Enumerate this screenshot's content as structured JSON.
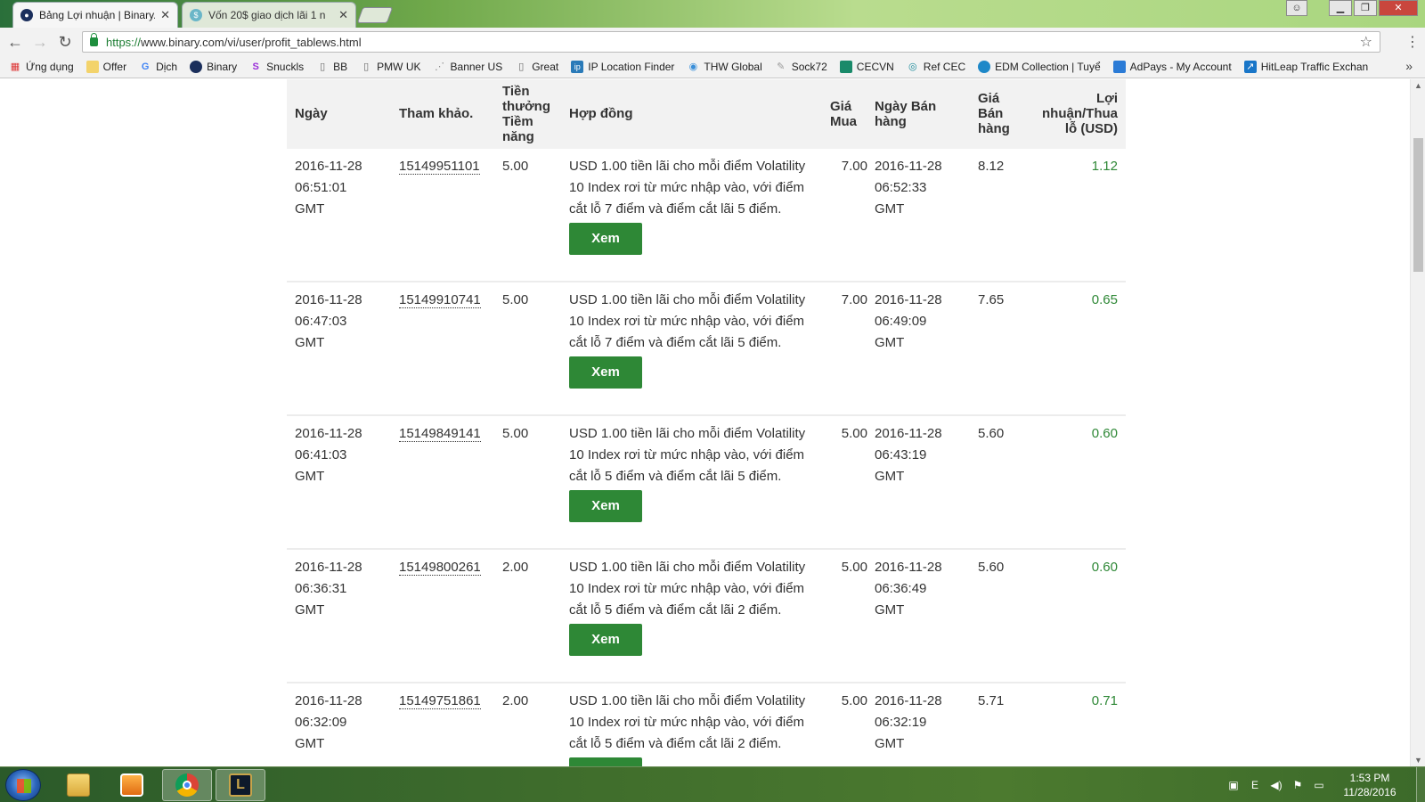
{
  "browser": {
    "tabs": [
      {
        "title": "Bảng Lợi nhuận | Binary.c",
        "active": true,
        "close": "✕"
      },
      {
        "title": "Vốn 20$ giao dịch lãi 1 n",
        "active": false,
        "close": "✕"
      }
    ],
    "url_prefix": "https://",
    "url_rest": "www.binary.com/vi/user/profit_tablews.html",
    "bookmarks": [
      {
        "label": "Ứng dụng",
        "icon": "apps-grid-icon"
      },
      {
        "label": "Offer",
        "icon": "folder-icon"
      },
      {
        "label": "Dịch",
        "icon": "google-icon"
      },
      {
        "label": "Binary",
        "icon": "binary-icon"
      },
      {
        "label": "Snuckls",
        "icon": "snuckls-icon"
      },
      {
        "label": "BB",
        "icon": "page-icon"
      },
      {
        "label": "PMW UK",
        "icon": "page-icon"
      },
      {
        "label": "Banner US",
        "icon": "banner-icon"
      },
      {
        "label": "Great",
        "icon": "page-icon"
      },
      {
        "label": "IP Location Finder",
        "icon": "ip-icon"
      },
      {
        "label": "THW Global",
        "icon": "thw-icon"
      },
      {
        "label": "Sock72",
        "icon": "sock-icon"
      },
      {
        "label": "CECVN",
        "icon": "cec-icon"
      },
      {
        "label": "Ref CEC",
        "icon": "ref-icon"
      },
      {
        "label": "EDM Collection | Tuyể",
        "icon": "edm-icon"
      },
      {
        "label": "AdPays - My Account",
        "icon": "adpays-icon"
      },
      {
        "label": "HitLeap Traffic Exchan",
        "icon": "hitleap-icon"
      }
    ]
  },
  "table": {
    "headers": {
      "date": "Ngày",
      "ref": "Tham khảo.",
      "payout": "Tiền thưởng Tiềm năng",
      "contract": "Hợp đồng",
      "buy_price": "Giá Mua",
      "sell_date": "Ngày Bán hàng",
      "sell_price": "Giá Bán hàng",
      "profit_loss": "Lợi nhuận/Thua lỗ (USD)"
    },
    "view_label": "Xem",
    "rows": [
      {
        "date": "2016-11-28",
        "time": "06:51:01",
        "tz": "GMT",
        "ref": "15149951101",
        "payout": "5.00",
        "contract": "USD 1.00 tiền lãi cho mỗi điểm Volatility 10 Index rơi từ mức nhập vào, với điểm cắt lỗ 7 điểm và điểm cắt lãi 5 điểm.",
        "buy_price": "7.00",
        "sell_date": "2016-11-28",
        "sell_time": "06:52:33",
        "sell_tz": "GMT",
        "sell_price": "8.12",
        "profit_loss": "1.12"
      },
      {
        "date": "2016-11-28",
        "time": "06:47:03",
        "tz": "GMT",
        "ref": "15149910741",
        "payout": "5.00",
        "contract": "USD 1.00 tiền lãi cho mỗi điểm Volatility 10 Index rơi từ mức nhập vào, với điểm cắt lỗ 7 điểm và điểm cắt lãi 5 điểm.",
        "buy_price": "7.00",
        "sell_date": "2016-11-28",
        "sell_time": "06:49:09",
        "sell_tz": "GMT",
        "sell_price": "7.65",
        "profit_loss": "0.65"
      },
      {
        "date": "2016-11-28",
        "time": "06:41:03",
        "tz": "GMT",
        "ref": "15149849141",
        "payout": "5.00",
        "contract": "USD 1.00 tiền lãi cho mỗi điểm Volatility 10 Index rơi từ mức nhập vào, với điểm cắt lỗ 5 điểm và điểm cắt lãi 5 điểm.",
        "buy_price": "5.00",
        "sell_date": "2016-11-28",
        "sell_time": "06:43:19",
        "sell_tz": "GMT",
        "sell_price": "5.60",
        "profit_loss": "0.60"
      },
      {
        "date": "2016-11-28",
        "time": "06:36:31",
        "tz": "GMT",
        "ref": "15149800261",
        "payout": "2.00",
        "contract": "USD 1.00 tiền lãi cho mỗi điểm Volatility 10 Index rơi từ mức nhập vào, với điểm cắt lỗ 5 điểm và điểm cắt lãi 2 điểm.",
        "buy_price": "5.00",
        "sell_date": "2016-11-28",
        "sell_time": "06:36:49",
        "sell_tz": "GMT",
        "sell_price": "5.60",
        "profit_loss": "0.60"
      },
      {
        "date": "2016-11-28",
        "time": "06:32:09",
        "tz": "GMT",
        "ref": "15149751861",
        "payout": "2.00",
        "contract": "USD 1.00 tiền lãi cho mỗi điểm Volatility 10 Index rơi từ mức nhập vào, với điểm cắt lỗ 5 điểm và điểm cắt lãi 2 điểm.",
        "buy_price": "5.00",
        "sell_date": "2016-11-28",
        "sell_time": "06:32:19",
        "sell_tz": "GMT",
        "sell_price": "5.71",
        "profit_loss": "0.71"
      }
    ]
  },
  "taskbar": {
    "apps": [
      {
        "name": "file-explorer-icon",
        "active": false
      },
      {
        "name": "media-player-icon",
        "active": false
      },
      {
        "name": "chrome-icon",
        "active": true
      },
      {
        "name": "league-of-legends-icon",
        "active": false
      }
    ],
    "time": "1:53 PM",
    "date": "11/28/2016"
  },
  "colors": {
    "profit_green": "#2e8836",
    "button_green": "#2e8836",
    "header_bg": "#f2f2f2"
  }
}
